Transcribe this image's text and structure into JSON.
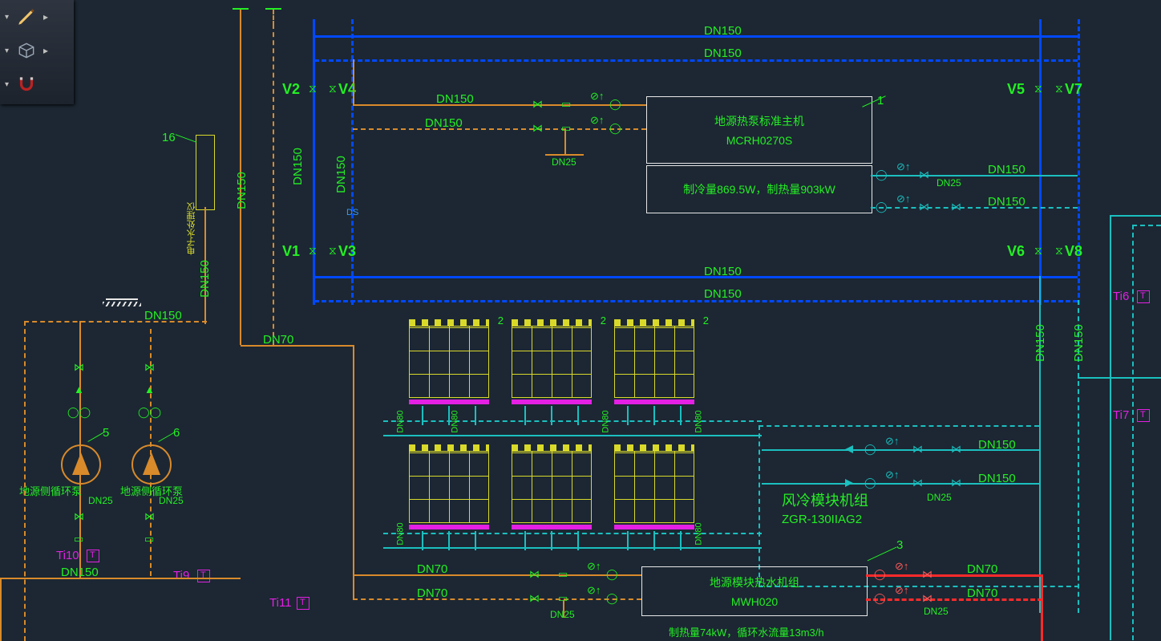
{
  "valves": {
    "v1": "V1",
    "v2": "V2",
    "v3": "V3",
    "v4": "V4",
    "v5": "V5",
    "v6": "V6",
    "v7": "V7",
    "v8": "V8"
  },
  "pipes": {
    "dn150": "DN150",
    "dn150b": "DN150",
    "dn150c": "DN150",
    "dn150d": "DN150",
    "dn150e": "DN150",
    "dn150f": "DN150",
    "dn150g": "DN150",
    "dn150h": "DN150",
    "dn150i": "DN150",
    "dn150j": "DN150",
    "dn150k": "DN150",
    "dn150l": "DN150",
    "dn150m": "DN150",
    "dn70": "DN70",
    "dn70b": "DN70",
    "dn70c": "DN70",
    "dn70d": "DN70",
    "dn70e": "DN70",
    "dn25": "DN25",
    "dn25b": "DN25",
    "dn25c": "DN25",
    "dn25d": "DN25",
    "dn25e": "DN25",
    "dn25f": "DN25",
    "dn80": "DN80",
    "dn80b": "DN80",
    "dn80c": "DN80",
    "dn80d": "DN80",
    "dn80e": "DN80",
    "dn80f": "DN80"
  },
  "equip": {
    "hp_title": "地源热泵标准主机",
    "hp_model": "MCRH0270S",
    "hp_rating": "制冷量869.5W，制热量903kW",
    "air_title": "风冷模块机组",
    "air_model": "ZGR-130IIAG2",
    "hw_title": "地源模块热水机组",
    "hw_model": "MWH020",
    "hw_rating": "制热量74kW，循环水流量13m3/h",
    "pump_label": "地源侧循环泵",
    "meter_label": "电子水处理仪"
  },
  "callouts": {
    "c1": "1",
    "c2": "2",
    "c3": "3",
    "c5": "5",
    "c6": "6",
    "c16": "16"
  },
  "sensors": {
    "ti6": "Ti6",
    "ti7": "Ti7",
    "ti9": "Ti9",
    "ti10": "Ti10",
    "ti11": "Ti11"
  },
  "dim": {
    "ds": "DS"
  }
}
